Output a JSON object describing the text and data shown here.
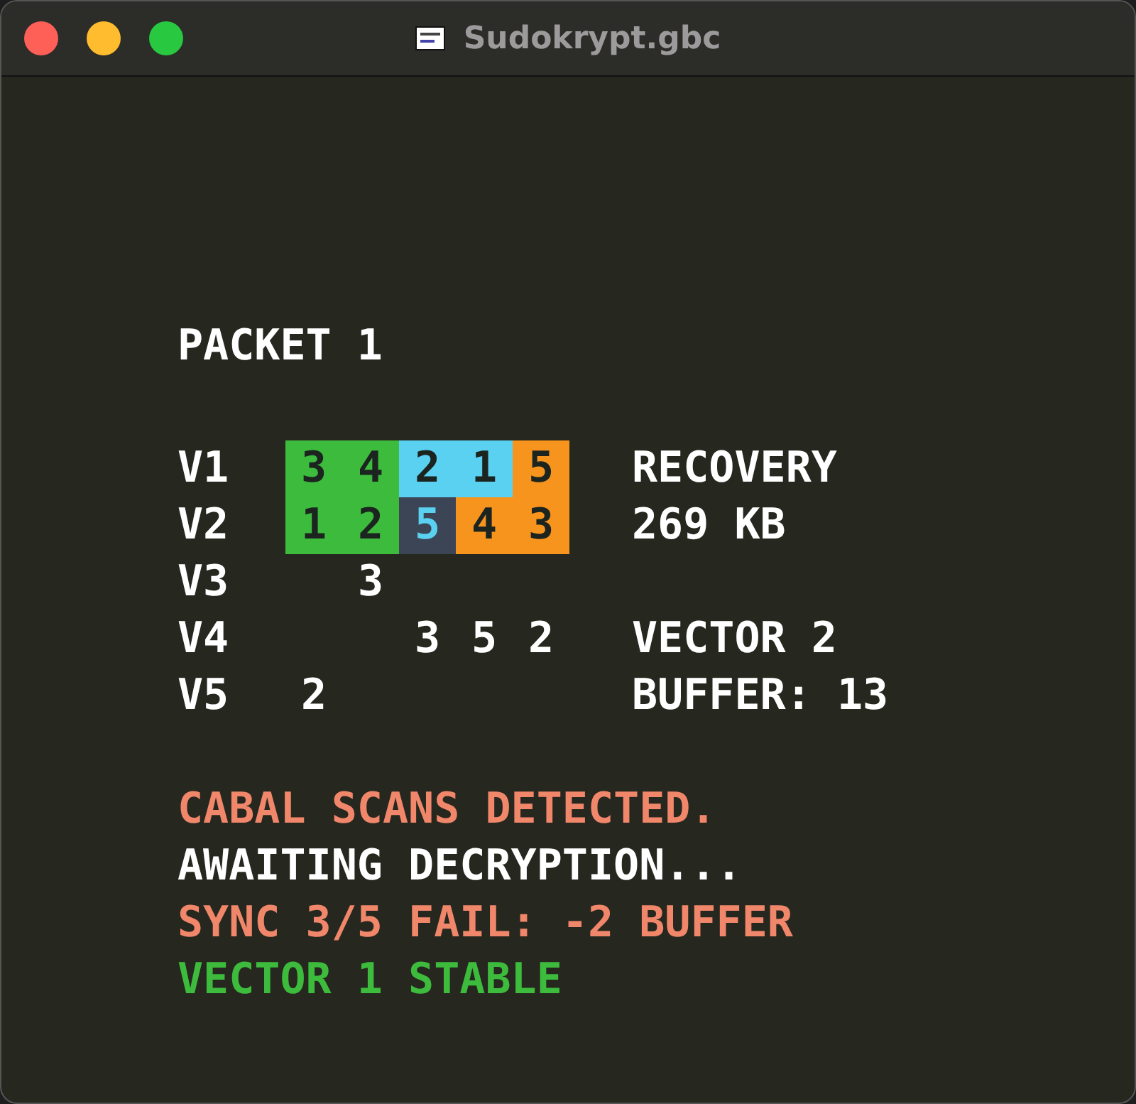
{
  "window": {
    "title": "Sudokrypt.gbc"
  },
  "heading": "PACKET 1",
  "rows": [
    {
      "label": "V1",
      "cells": [
        {
          "value": "3",
          "color": "#3dbb3d"
        },
        {
          "value": "4",
          "color": "#3dbb3d"
        },
        {
          "value": "2",
          "color": "#5bd1f2"
        },
        {
          "value": "1",
          "color": "#5bd1f2"
        },
        {
          "value": "5",
          "color": "#f7941d"
        }
      ],
      "side": "RECOVERY"
    },
    {
      "label": "V2",
      "cells": [
        {
          "value": "1",
          "color": "#3dbb3d"
        },
        {
          "value": "2",
          "color": "#3dbb3d"
        },
        {
          "value": "5",
          "color": "#3b4556"
        },
        {
          "value": "4",
          "color": "#f7941d"
        },
        {
          "value": "3",
          "color": "#f7941d"
        }
      ],
      "side": "269 KB"
    },
    {
      "label": "V3",
      "cells": [
        null,
        {
          "value": "3"
        },
        null,
        null,
        null
      ]
    },
    {
      "label": "V4",
      "cells": [
        null,
        null,
        {
          "value": "3"
        },
        {
          "value": "5"
        },
        {
          "value": "2"
        }
      ],
      "side": "VECTOR 2"
    },
    {
      "label": "V5",
      "cells": [
        {
          "value": "2"
        },
        null,
        null,
        null,
        null
      ],
      "side": "BUFFER: 13"
    }
  ],
  "messages": [
    {
      "text": "CABAL SCANS DETECTED.",
      "color": "#f0866a"
    },
    {
      "text": "AWAITING DECRYPTION...",
      "color": "#ffffff"
    },
    {
      "text": "SYNC 3/5 FAIL: -2 BUFFER",
      "color": "#f0866a"
    },
    {
      "text": "VECTOR 1 STABLE",
      "color": "#3dbb3d"
    }
  ]
}
